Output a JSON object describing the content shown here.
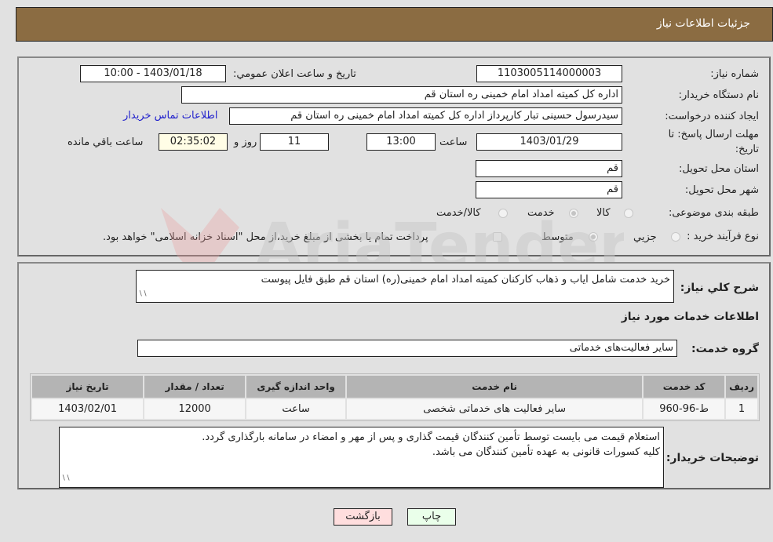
{
  "header": {
    "title": "جزئیات اطلاعات نیاز"
  },
  "form": {
    "need_number": {
      "label": "شماره نیاز:",
      "value": "1103005114000003"
    },
    "announce_datetime": {
      "label": "تاریخ و ساعت اعلان عمومي:",
      "value": "1403/01/18 - 10:00"
    },
    "buyer_org": {
      "label": "نام دستگاه خریدار:",
      "value": "اداره کل کمیته امداد امام خمینی  ره  استان قم"
    },
    "requester": {
      "label": "ایجاد کننده درخواست:",
      "value": "سیدرسول حسینی تبار کارپرداز اداره کل کمیته امداد امام خمینی  ره  استان قم",
      "contact_link": "اطلاعات تماس خریدار"
    },
    "deadline": {
      "label_line1": "مهلت ارسال پاسخ: تا",
      "label_line2": "تاریخ:",
      "date": "1403/01/29",
      "time_label": "ساعت",
      "time": "13:00",
      "days": "11",
      "days_label": "روز و",
      "remaining": "02:35:02",
      "remaining_label": "ساعت باقي مانده"
    },
    "delivery_province": {
      "label": "استان محل تحویل:",
      "value": "قم"
    },
    "delivery_city": {
      "label": "شهر محل تحویل:",
      "value": "قم"
    },
    "category": {
      "label": "طبقه بندی موضوعی:",
      "options": [
        {
          "label": "کالا",
          "checked": false
        },
        {
          "label": "خدمت",
          "checked": true
        },
        {
          "label": "کالا/خدمت",
          "checked": false
        }
      ]
    },
    "purchase_type": {
      "label": "نوع فرآیند خرید :",
      "options": [
        {
          "label": "جزيي",
          "checked": false
        },
        {
          "label": "متوسط",
          "checked": true
        }
      ],
      "treasury_note": "پرداخت تمام یا بخشی از مبلغ خرید،از محل \"اسناد خزانه اسلامی\" خواهد بود."
    }
  },
  "details": {
    "description_label": "شرح کلي نیاز:",
    "description": "خرید خدمت شامل ایاب و ذهاب کارکنان کمیته امداد امام خمینی(ره) استان قم طبق فایل پیوست",
    "services_heading": "اطلاعات خدمات مورد نیاز",
    "service_group_label": "گروه خدمت:",
    "service_group": "سایر فعالیت‌های خدماتی",
    "table": {
      "headers": [
        "ردیف",
        "کد خدمت",
        "نام خدمت",
        "واحد اندازه گیری",
        "تعداد / مقدار",
        "تاریخ نیاز"
      ],
      "rows": [
        [
          "1",
          "ط-96-960",
          "سایر فعالیت های خدماتی شخصی",
          "ساعت",
          "12000",
          "1403/02/01"
        ]
      ]
    },
    "buyer_notes_label": "توضیحات خریدار:",
    "buyer_notes_line1": "استعلام قیمت می بایست توسط تأمین کنندگان قیمت گذاری و پس از مهر و امضاء در سامانه بارگذاری گردد.",
    "buyer_notes_line2": "کلیه کسورات قانونی به عهده تأمین کنندگان می باشد."
  },
  "buttons": {
    "print": "چاپ",
    "back": "بازگشت"
  },
  "watermark": {
    "text": "AriaTender.neT"
  },
  "colors": {
    "header_bg": "#8b6c42",
    "print_bg": "#eaffea",
    "back_bg": "#ffdede",
    "link": "#2222cc"
  }
}
